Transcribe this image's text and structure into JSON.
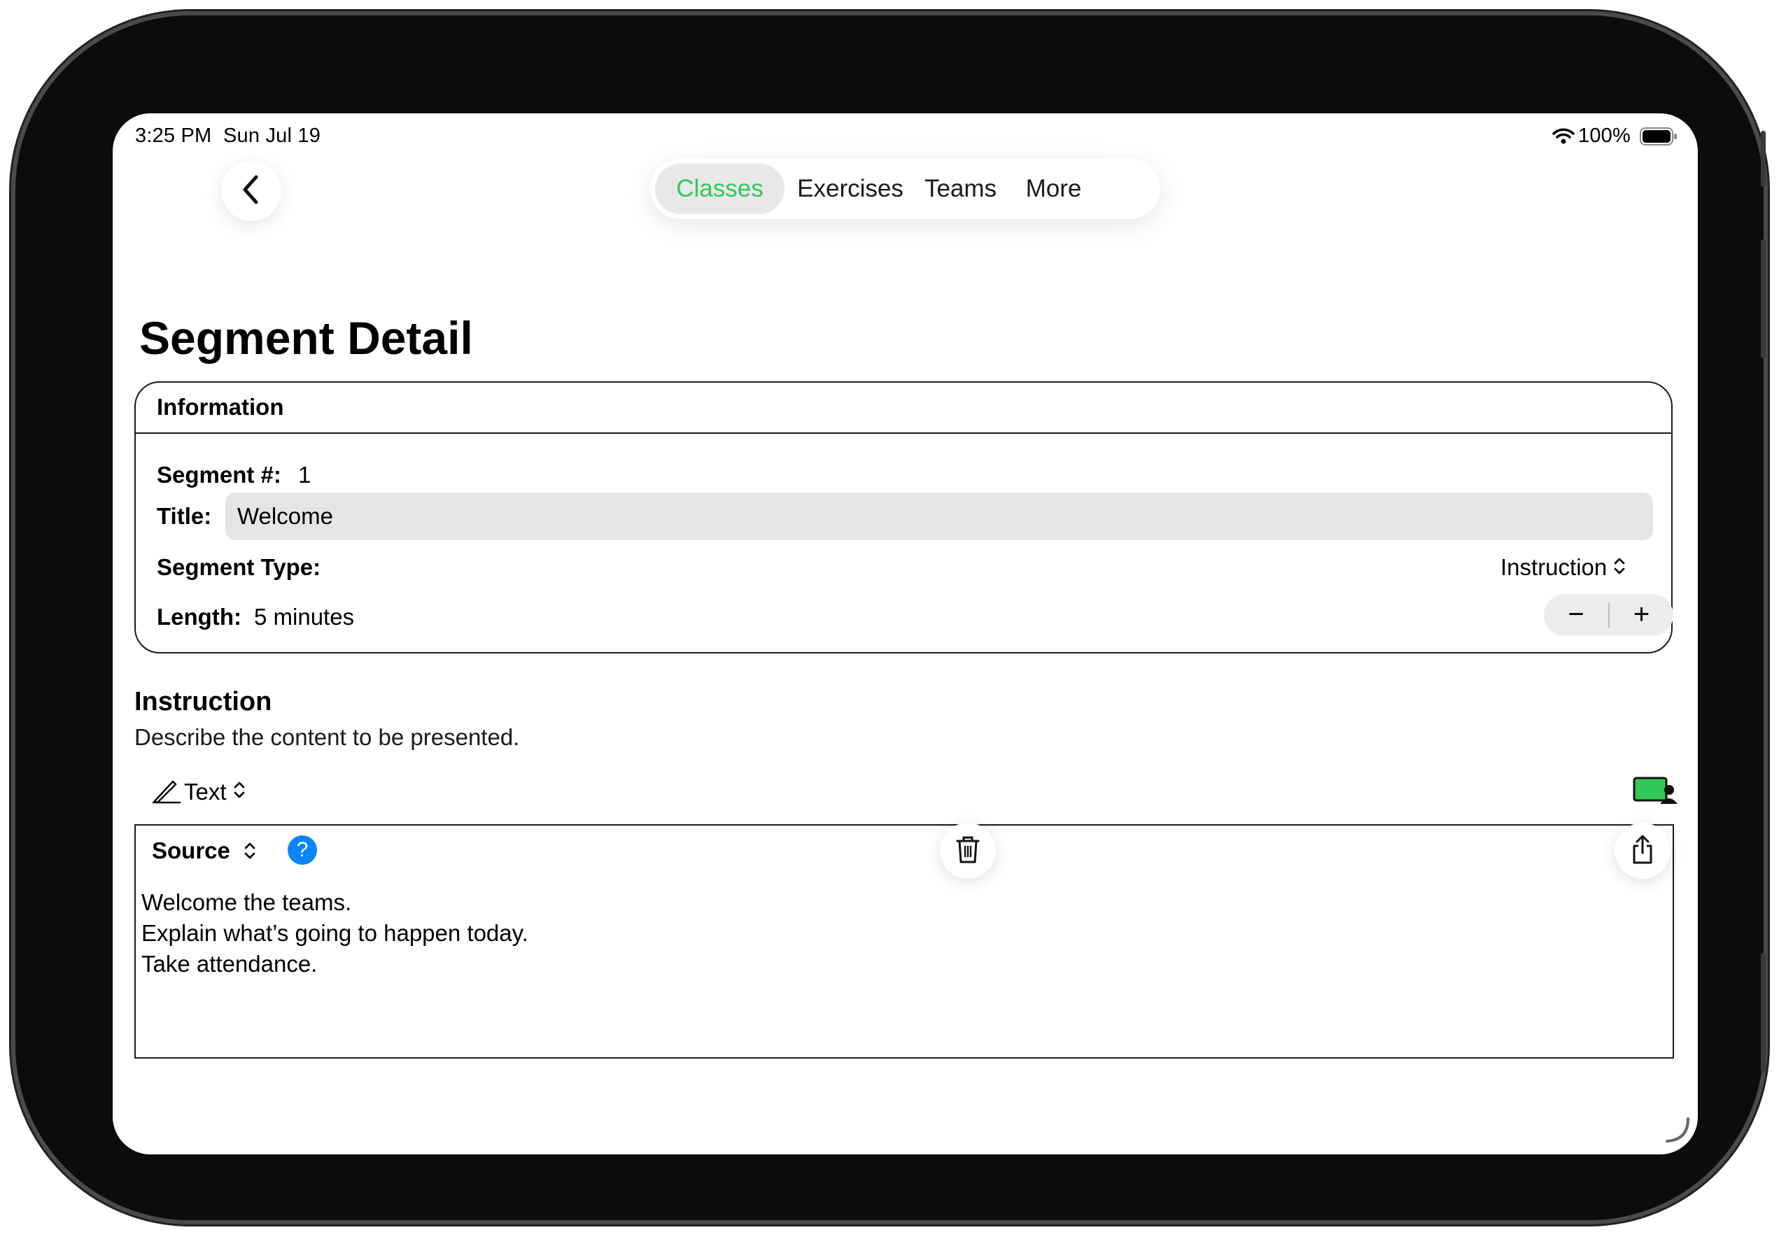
{
  "status_bar": {
    "time": "3:25 PM",
    "date": "Sun Jul 19",
    "battery": "100%",
    "icons": [
      "wifi-icon",
      "battery-icon"
    ]
  },
  "nav": {
    "back_icon": "chevron-left-icon",
    "tabs": [
      {
        "label": "Classes",
        "active": true
      },
      {
        "label": "Exercises",
        "active": false
      },
      {
        "label": "Teams",
        "active": false
      },
      {
        "label": "More",
        "active": false
      }
    ],
    "active_color": "#34c759"
  },
  "page": {
    "title": "Segment Detail"
  },
  "information": {
    "header": "Information",
    "segment_number_label": "Segment #:",
    "segment_number": "1",
    "title_label": "Title:",
    "title_value": "Welcome",
    "segment_type_label": "Segment Type:",
    "segment_type_value": "Instruction",
    "length_label": "Length:",
    "length_value": "5 minutes",
    "stepper": {
      "decrement": "−",
      "increment": "+"
    }
  },
  "instruction": {
    "title": "Instruction",
    "subtitle": "Describe the content to be presented.",
    "mode_label": "Text",
    "source_label": "Source",
    "help_label": "?",
    "help_color": "#0a84ff",
    "presenter_icon_color": "#34c759",
    "lines": [
      "Welcome the teams.",
      "Explain what’s going to happen today.",
      "Take attendance."
    ]
  }
}
